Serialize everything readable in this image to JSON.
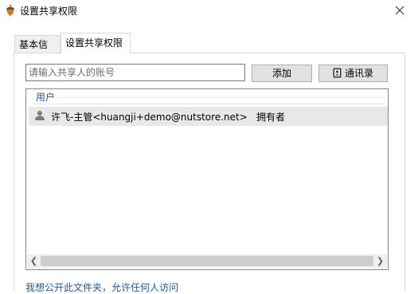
{
  "window": {
    "title": "设置共享权限"
  },
  "tabs": [
    {
      "label": "基本信息",
      "active": false
    },
    {
      "label": "设置共享权限",
      "active": true
    }
  ],
  "search": {
    "placeholder": "请输入共享人的账号",
    "value": ""
  },
  "buttons": {
    "add_label": "添加",
    "contacts_label": "通讯录"
  },
  "list": {
    "header": "用户",
    "rows": [
      {
        "name": "许飞-主管<huangji+demo@nutstore.net>",
        "role": "拥有者"
      }
    ]
  },
  "public_link": "我想公开此文件夹，允许任何人访问",
  "colors": {
    "link": "#1e5aa8",
    "selected_row": "#e8e8e8"
  },
  "icons": {
    "app": "acorn-icon",
    "close": "close-icon",
    "contacts": "address-book-icon",
    "user": "user-icon"
  }
}
